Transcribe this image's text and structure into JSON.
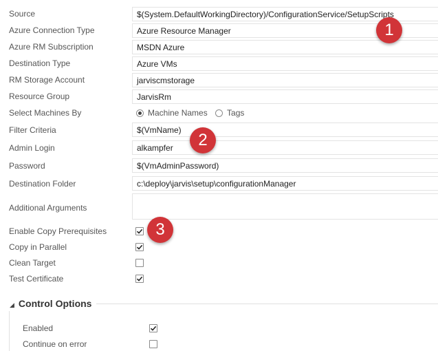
{
  "fields": [
    {
      "label": "Source",
      "value": "$(System.DefaultWorkingDirectory)/ConfigurationService/SetupScripts"
    },
    {
      "label": "Azure Connection Type",
      "value": "Azure Resource Manager"
    },
    {
      "label": "Azure RM Subscription",
      "value": "MSDN Azure"
    },
    {
      "label": "Destination Type",
      "value": "Azure VMs"
    },
    {
      "label": "RM Storage Account",
      "value": "jarviscmstorage"
    },
    {
      "label": "Resource Group",
      "value": "JarvisRm"
    }
  ],
  "select_machines": {
    "label": "Select Machines By",
    "options": [
      "Machine Names",
      "Tags"
    ],
    "selected": "Machine Names"
  },
  "fields2": [
    {
      "label": "Filter Criteria",
      "value": "$(VmName)"
    },
    {
      "label": "Admin Login",
      "value": "alkampfer"
    },
    {
      "label": "Password",
      "value": "$(VmAdminPassword)"
    },
    {
      "label": "Destination Folder",
      "value": "c:\\deploy\\jarvis\\setup\\configurationManager"
    },
    {
      "label": "Additional Arguments",
      "value": ""
    }
  ],
  "checkboxes": [
    {
      "label": "Enable Copy Prerequisites",
      "checked": true
    },
    {
      "label": "Copy in Parallel",
      "checked": true
    },
    {
      "label": "Clean Target",
      "checked": false
    },
    {
      "label": "Test Certificate",
      "checked": true
    }
  ],
  "control_options": {
    "title": "Control Options",
    "items": [
      {
        "label": "Enabled",
        "checked": true
      },
      {
        "label": "Continue on error",
        "checked": false
      }
    ]
  },
  "badges": [
    "1",
    "2",
    "3"
  ],
  "colors": {
    "badge": "#d13438",
    "border": "#e3e3e3",
    "label": "#555555"
  }
}
